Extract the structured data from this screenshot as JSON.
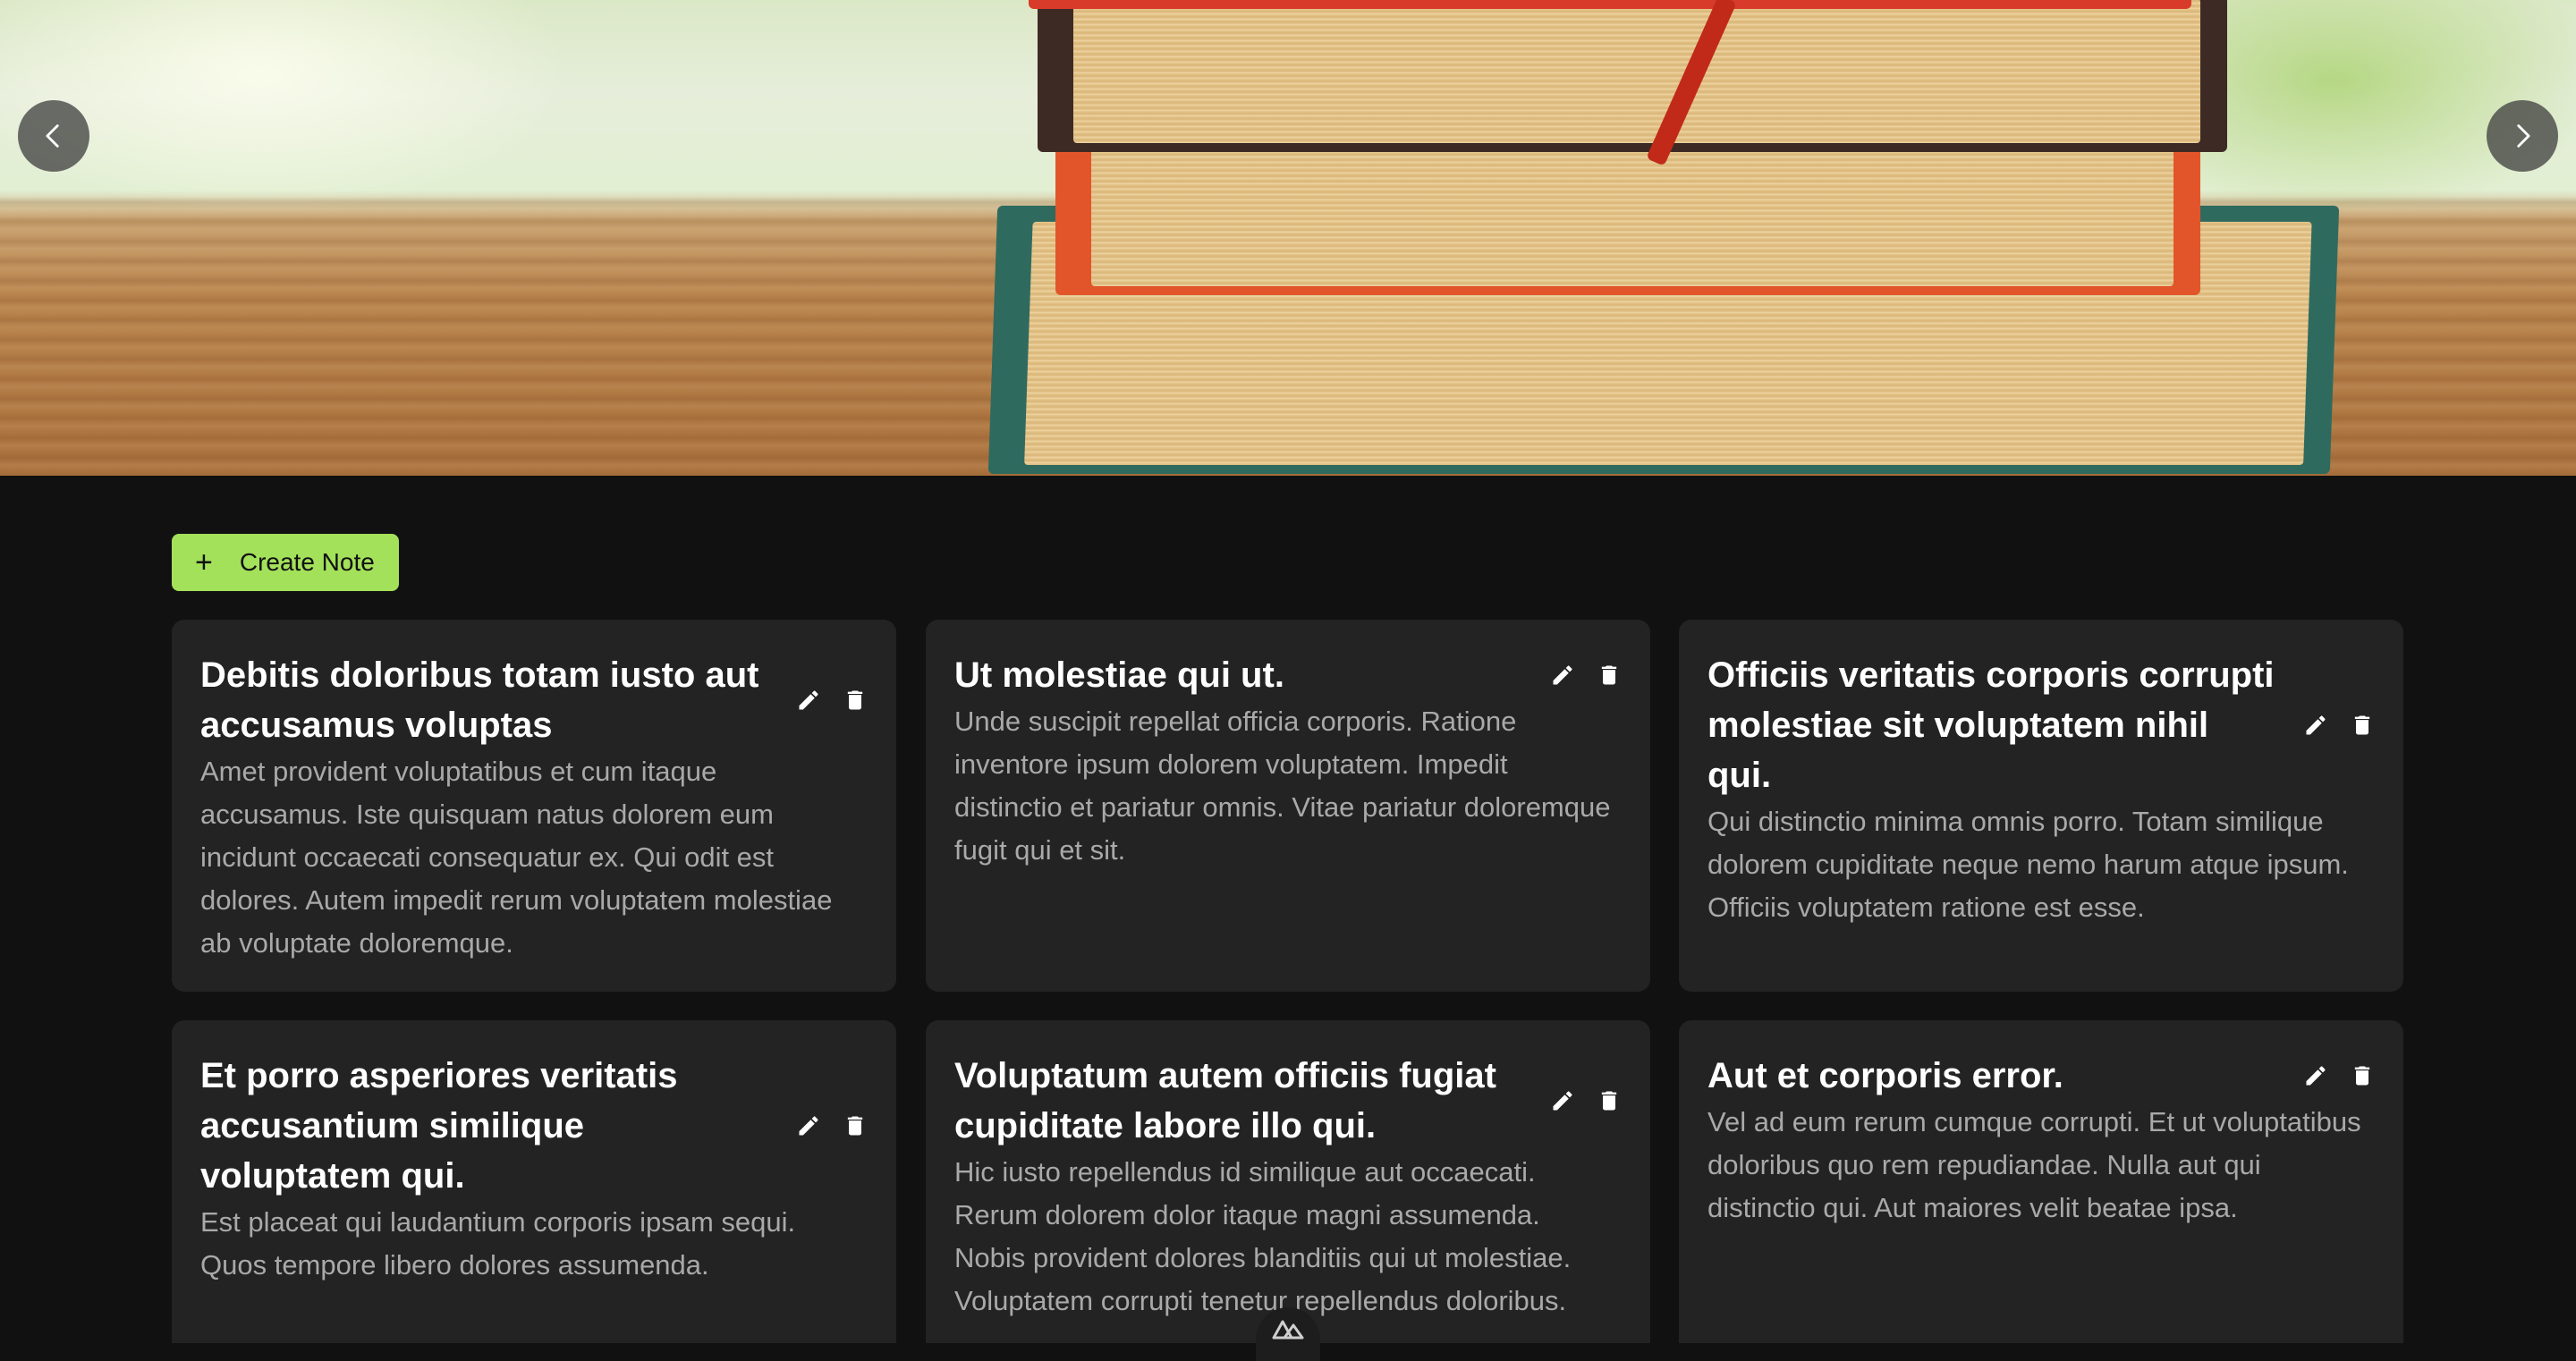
{
  "hero": {
    "prev_icon": "chevron-left-icon",
    "next_icon": "chevron-right-icon"
  },
  "toolbar": {
    "create_icon": "+",
    "create_label": "Create Note",
    "create_color": "#a3e15a"
  },
  "notes": [
    {
      "title": "Debitis doloribus totam iusto aut accusamus voluptas",
      "body": "Amet provident voluptatibus et cum itaque accusamus. Iste quisquam natus dolorem eum incidunt occaecati consequatur ex. Qui odit est dolores. Autem impedit rerum voluptatem molestiae ab voluptate doloremque."
    },
    {
      "title": "Ut molestiae qui ut.",
      "body": "Unde suscipit repellat officia corporis. Ratione inventore ipsum dolorem voluptatem. Impedit distinctio et pariatur omnis. Vitae pariatur doloremque fugit qui et sit."
    },
    {
      "title": "Officiis veritatis corporis corrupti molestiae sit voluptatem nihil qui.",
      "body": "Qui distinctio minima omnis porro. Totam similique dolorem cupiditate neque nemo harum atque ipsum. Officiis voluptatem ratione est esse."
    },
    {
      "title": "Et porro asperiores veritatis accusantium similique voluptatem qui.",
      "body": "Est placeat qui laudantium corporis ipsam sequi. Quos tempore libero dolores assumenda."
    },
    {
      "title": "Voluptatum autem officiis fugiat cupiditate labore illo qui.",
      "body": "Hic iusto repellendus id similique aut occaecati. Rerum dolorem dolor itaque magni assumenda. Nobis provident dolores blanditiis qui ut molestiae. Voluptatem corrupti tenetur repellendus doloribus."
    },
    {
      "title": "Aut et corporis error.",
      "body": "Vel ad eum rerum cumque corrupti. Et ut voluptatibus doloribus quo rem repudiandae. Nulla aut qui distinctio qui. Aut maiores velit beatae ipsa."
    }
  ],
  "colors": {
    "background": "#111111",
    "card": "#232323",
    "title": "#ffffff",
    "body_text": "#a9a9a9"
  }
}
